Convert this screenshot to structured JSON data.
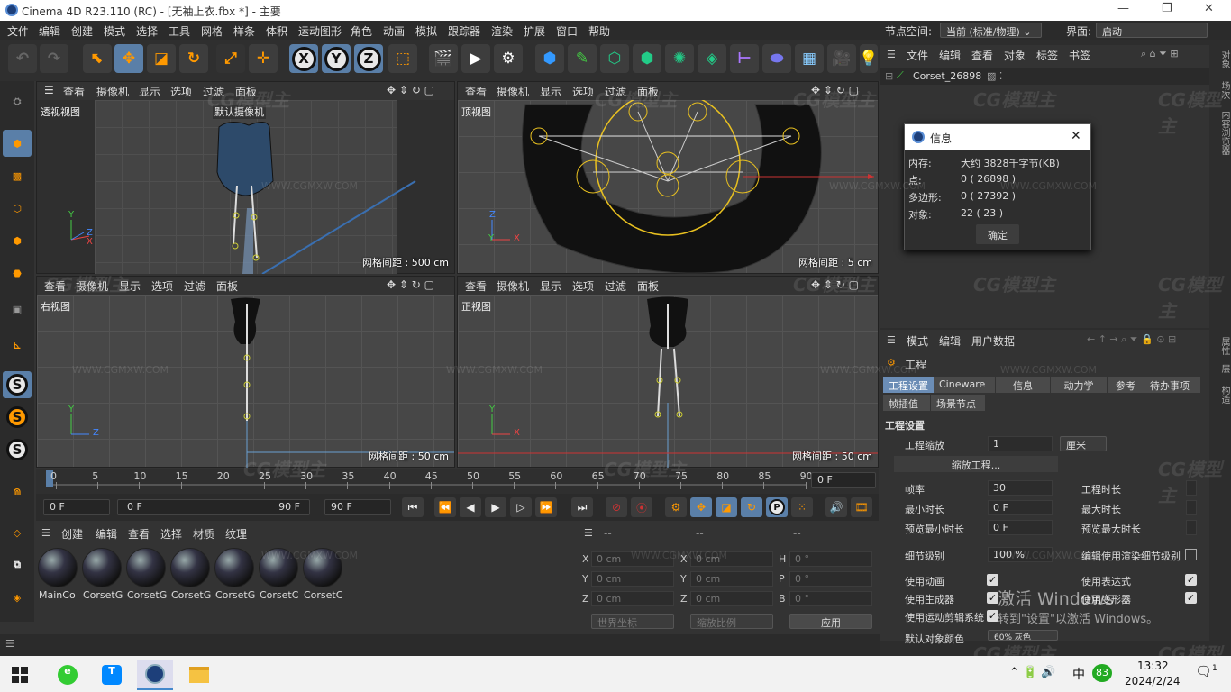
{
  "window": {
    "title": "Cinema 4D R23.110 (RC) - [无袖上衣.fbx *] - 主要"
  },
  "menu": [
    "文件",
    "编辑",
    "创建",
    "模式",
    "选择",
    "工具",
    "网格",
    "样条",
    "体积",
    "运动图形",
    "角色",
    "动画",
    "模拟",
    "跟踪器",
    "渲染",
    "扩展",
    "窗口",
    "帮助"
  ],
  "nodespace": {
    "label": "节点空间:",
    "value": "当前 (标准/物理)"
  },
  "layout": {
    "label": "界面:",
    "value": "启动"
  },
  "viewport_menu": [
    "查看",
    "摄像机",
    "显示",
    "选项",
    "过滤",
    "面板"
  ],
  "viewports": [
    {
      "name": "透视视图",
      "camera": "默认摄像机",
      "grid": "网格间距 : 500 cm",
      "axes": [
        "Y",
        "Z",
        "X"
      ]
    },
    {
      "name": "顶视图",
      "grid": "网格间距 : 5 cm",
      "axes": [
        "Z",
        "Y",
        "X"
      ]
    },
    {
      "name": "右视图",
      "grid": "网格间距 : 50 cm",
      "axes": [
        "Y",
        "Z"
      ]
    },
    {
      "name": "正视图",
      "grid": "网格间距 : 50 cm",
      "axes": [
        "Y",
        "X"
      ]
    }
  ],
  "timeline": {
    "ticks": [
      "0",
      "5",
      "10",
      "15",
      "20",
      "25",
      "30",
      "35",
      "40",
      "45",
      "50",
      "55",
      "60",
      "65",
      "70",
      "75",
      "80",
      "85",
      "90"
    ],
    "current": "0 F"
  },
  "playback": {
    "start": "0 F",
    "range_start": "0 F",
    "range_end": "90 F",
    "end": "90 F"
  },
  "materials": {
    "menu": [
      "创建",
      "编辑",
      "查看",
      "选择",
      "材质",
      "纹理"
    ],
    "items": [
      "MainCo",
      "CorsetG",
      "CorsetG",
      "CorsetG",
      "CorsetG",
      "CorsetC",
      "CorsetC"
    ]
  },
  "coords": {
    "headers": [
      "--",
      "--",
      "--"
    ],
    "rows": [
      {
        "a": "X",
        "av": "0 cm",
        "b": "X",
        "bv": "0 cm",
        "c": "H",
        "cv": "0 °"
      },
      {
        "a": "Y",
        "av": "0 cm",
        "b": "Y",
        "bv": "0 cm",
        "c": "P",
        "cv": "0 °"
      },
      {
        "a": "Z",
        "av": "0 cm",
        "b": "Z",
        "bv": "0 cm",
        "c": "B",
        "cv": "0 °"
      }
    ],
    "world": "世界坐标",
    "scale": "缩放比例",
    "apply": "应用"
  },
  "objmgr": {
    "menu": [
      "文件",
      "编辑",
      "查看",
      "对象",
      "标签",
      "书签"
    ],
    "object": "Corset_26898"
  },
  "info_dialog": {
    "title": "信息",
    "rows": [
      {
        "k": "内存:",
        "v": "大约 3828千字节(KB)"
      },
      {
        "k": "点:",
        "v": "0 ( 26898 )"
      },
      {
        "k": "多边形:",
        "v": "0 ( 27392 )"
      },
      {
        "k": "对象:",
        "v": "22 ( 23 )"
      }
    ],
    "ok": "确定"
  },
  "attr": {
    "menu": [
      "模式",
      "编辑",
      "用户数据"
    ],
    "title": "工程",
    "tabs": [
      "工程设置",
      "Cineware",
      "信息",
      "动力学",
      "参考",
      "待办事项"
    ],
    "tabs2": [
      "帧插值",
      "场景节点"
    ],
    "section": "工程设置",
    "scale_label": "工程缩放",
    "scale_value": "1",
    "scale_unit": "厘米",
    "scale_btn": "缩放工程...",
    "fps_label": "帧率",
    "fps": "30",
    "proj_time_label": "工程时长",
    "min_time_label": "最小时长",
    "min_time": "0 F",
    "max_time_label": "最大时长",
    "prev_min_label": "预览最小时长",
    "prev_min": "0 F",
    "prev_max_label": "预览最大时长",
    "lod_label": "细节级别",
    "lod": "100 %",
    "render_lod_label": "编辑使用渲染细节级别",
    "use_anim": "使用动画",
    "use_expr": "使用表达式",
    "use_gen": "使用生成器",
    "use_deform": "使用变形器",
    "use_motion": "使用运动剪辑系统",
    "default_color": "默认对象颜色",
    "default_color_value": "60% 灰色"
  },
  "right_tabs": [
    "对象",
    "场次",
    "内容浏览器"
  ],
  "right_tabs2": [
    "属性",
    "层",
    "构造"
  ],
  "activate": {
    "line1": "激活 Windows",
    "line2": "转到\"设置\"以激活 Windows。"
  },
  "watermark": "CG模型主",
  "watermark_url": "WWW.CGMXW.COM",
  "taskbar": {
    "time": "13:32",
    "date": "2024/2/24",
    "ime": "中",
    "badge": "83",
    "notif": "1"
  }
}
